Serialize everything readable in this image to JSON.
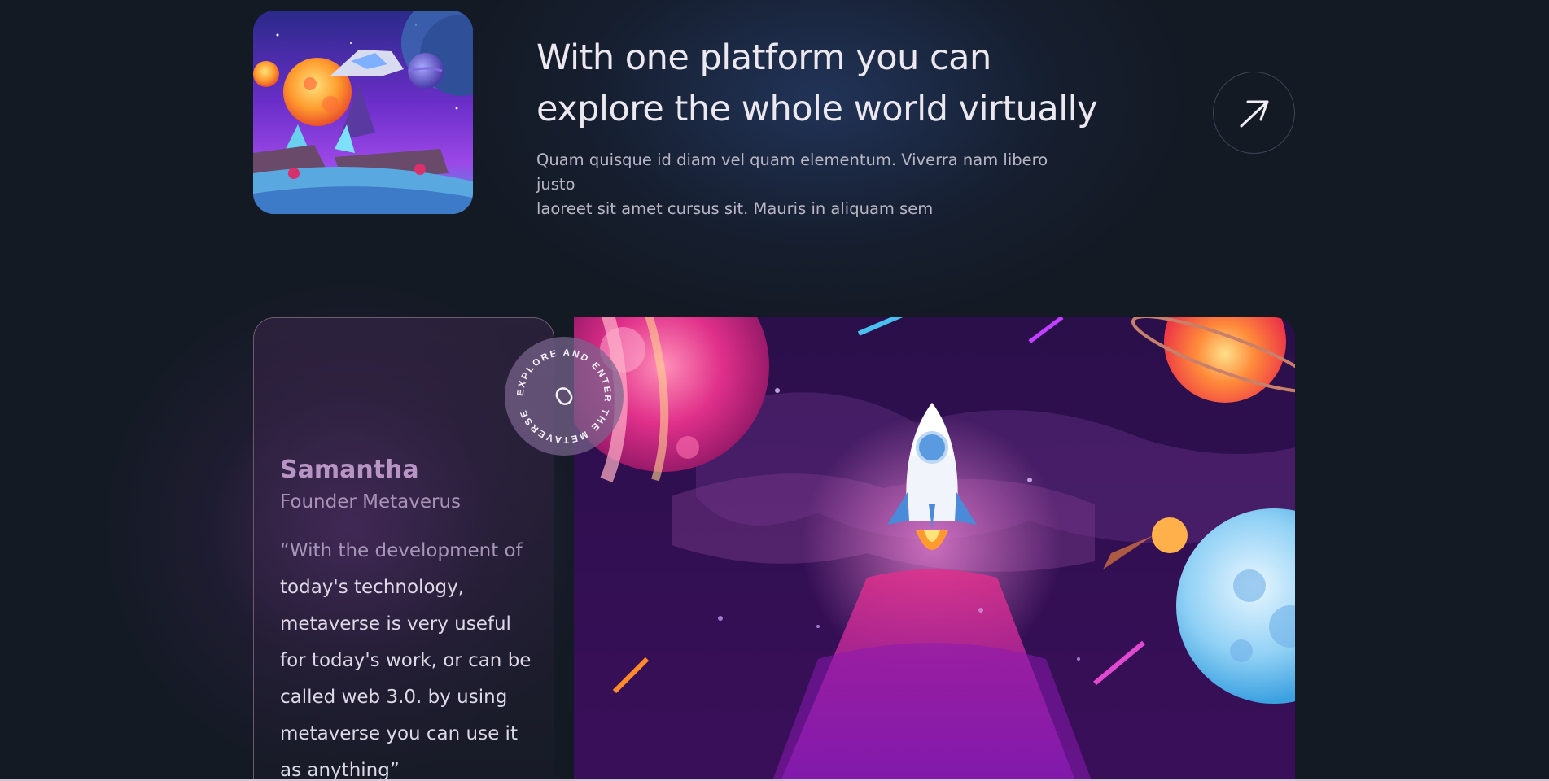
{
  "feature": {
    "title_line1": "With one platform you can",
    "title_line2": "explore the whole world virtually",
    "description_line1": "Quam quisque id diam vel quam elementum. Viverra nam libero justo",
    "description_line2": "laoreet sit amet cursus sit. Mauris in aliquam sem",
    "thumbnail_icon": "space-game-illustration",
    "arrow_icon": "arrow-up-right-icon"
  },
  "testimonial": {
    "name": "Samantha",
    "role": "Founder Metaverus",
    "quote_lines": [
      "“With the development of",
      "today's technology,",
      "metaverse is very useful",
      "for today's work, or can be",
      "called web 3.0. by using",
      "metaverse you can use it",
      "as anything”"
    ]
  },
  "badge": {
    "text": "EXPLORE AND ENTER THE METAVERSE",
    "icon": "chain-link-icon"
  },
  "hero": {
    "icon": "rocket-launch-illustration"
  },
  "colors": {
    "background": "#141a24",
    "accent_purple": "#b794c4",
    "border": "#6e5a6e"
  }
}
